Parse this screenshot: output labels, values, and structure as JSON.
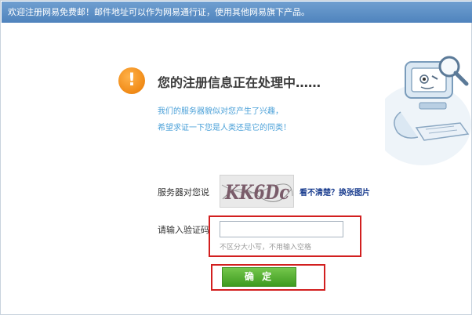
{
  "top_bar": {
    "text": "欢迎注册网易免费邮！邮件地址可以作为网易通行证，使用其他网易旗下产品。"
  },
  "notice": {
    "icon": "exclamation-icon",
    "title": "您的注册信息正在处理中……",
    "line1": "我们的服务器貌似对您产生了兴趣，",
    "line2": "希望求证一下您是人类还是它的同类！"
  },
  "captcha": {
    "label": "服务器对您说",
    "image_text": "KK6Dc",
    "refresh_link": "看不清楚？换张图片"
  },
  "code": {
    "label": "请输入验证码",
    "value": "",
    "hint": "不区分大小写，不用输入空格"
  },
  "confirm_button": {
    "label": "确 定"
  },
  "colors": {
    "accent": "#4f83bd",
    "button": "#3e9b1f",
    "highlight": "#d21f1f",
    "warning": "#f08a16"
  }
}
